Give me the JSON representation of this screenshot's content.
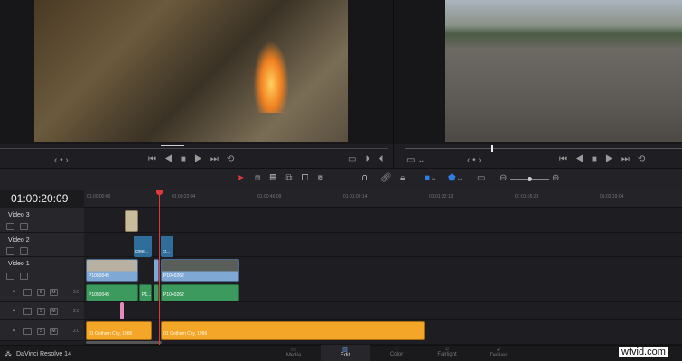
{
  "timeline": {
    "timecode": "01:00:20:09",
    "ruler": [
      "01:00:00:00",
      "01:00:23:04",
      "01:00:46:09",
      "01:01:09:14",
      "01:01:32:13",
      "01:01:55:23",
      "01:02:19:04"
    ]
  },
  "tracks": {
    "video": [
      "Video 3",
      "Video 2",
      "Video 1"
    ],
    "audio_level": "2.0",
    "solo": "S",
    "mute": "M"
  },
  "clips": {
    "v2a": "cree...",
    "v2b": "cr...",
    "v1a": "P1050048",
    "v1b": "P1040262",
    "a1a": "P1050048",
    "a1b": "P1...",
    "a1c": "P1040262",
    "a3a": "01 Gotham City, 1986",
    "a3b": "01 Gotham City, 1986"
  },
  "app": {
    "name": "DaVinci Resolve 14"
  },
  "pages": [
    "Media",
    "Edit",
    "Color",
    "Fairlight",
    "Deliver"
  ],
  "watermark": "wtvid.com",
  "colors": {
    "playhead": "#e0393a",
    "video": "#7fa8d4",
    "audio": "#3c9a5e",
    "music": "#f4a629"
  }
}
